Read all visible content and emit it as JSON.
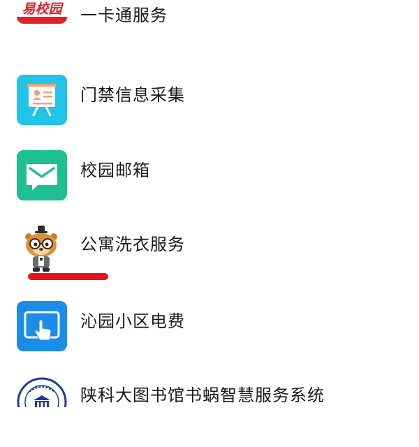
{
  "items": [
    {
      "label": "一卡通服务",
      "icon": "yixiaoyuan-logo-icon",
      "icon_text": "易校园",
      "color": "#e3202a"
    },
    {
      "label": "门禁信息采集",
      "icon": "id-board-icon",
      "color": "#1fc4e6"
    },
    {
      "label": "校园邮箱",
      "icon": "mail-icon",
      "color": "#1fbf8f"
    },
    {
      "label": "公寓洗衣服务",
      "icon": "mascot-icon"
    },
    {
      "label": "沁园小区电费",
      "icon": "tablet-touch-icon",
      "color": "#1a8de9"
    },
    {
      "label": "陕科大图书馆书蜗智慧服务系统",
      "icon": "library-seal-icon",
      "color": "#1a3f8f"
    }
  ],
  "annotation": {
    "color": "#e5131b"
  }
}
